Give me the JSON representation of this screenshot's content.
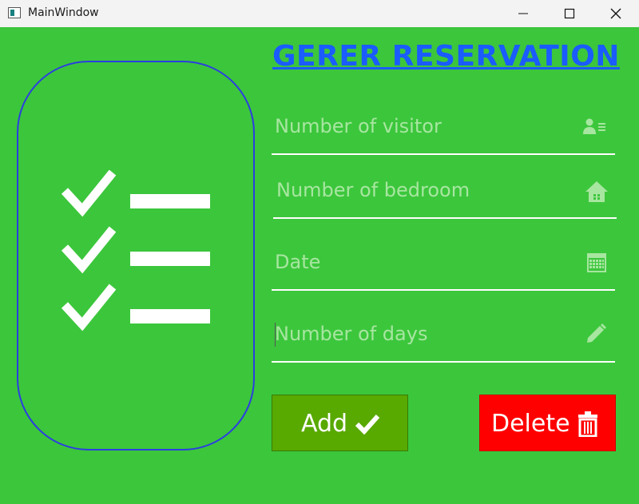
{
  "window": {
    "title": "MainWindow"
  },
  "form": {
    "heading": "GERER RESERVATION",
    "fields": [
      {
        "placeholder": "Number of visitor",
        "icon": "contact-card-icon"
      },
      {
        "placeholder": "Number of bedroom",
        "icon": "home-icon"
      },
      {
        "placeholder": "Date",
        "icon": "calendar-icon"
      },
      {
        "placeholder": "Number of days",
        "icon": "pencil-icon"
      }
    ]
  },
  "buttons": {
    "add_label": "Add",
    "delete_label": "Delete"
  },
  "colors": {
    "background": "#3cc63c",
    "heading": "#1a5cff",
    "add_button": "#58a900",
    "delete_button": "#ff0000",
    "placeholder_text": "#a7e6a0",
    "illustration_border": "#2b3ee0"
  }
}
